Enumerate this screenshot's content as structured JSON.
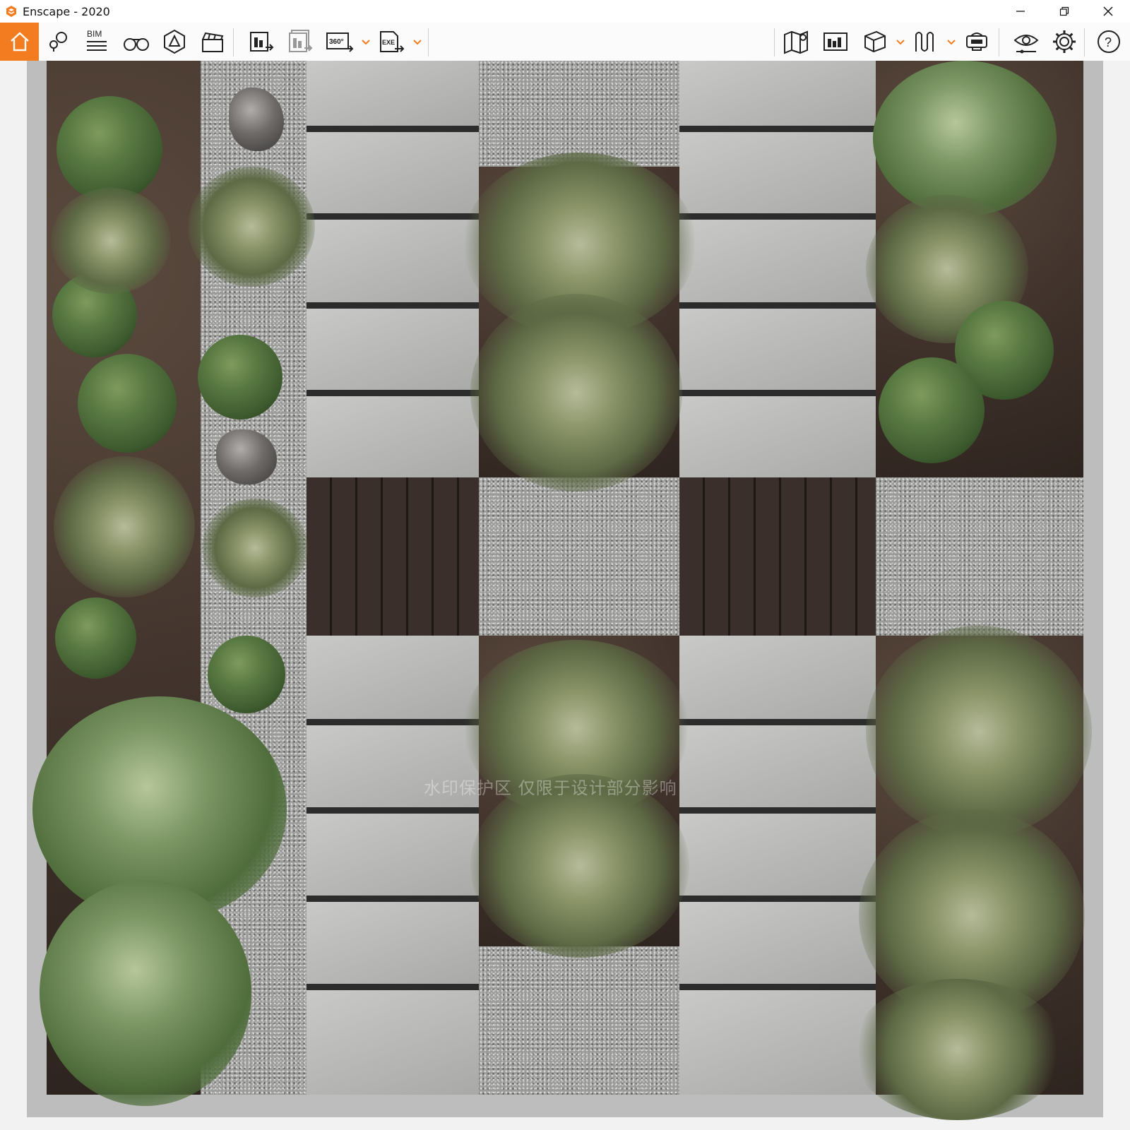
{
  "window": {
    "app_name": "Enscape - 2020",
    "controls": [
      "minimize-icon",
      "restore-icon",
      "close-icon"
    ]
  },
  "toolbar": {
    "accent_color": "#f47c20",
    "left_tools": [
      {
        "icon": "home-icon"
      },
      {
        "icon": "location-pins-icon"
      },
      {
        "icon": "bim-list-icon",
        "label": "BIM"
      },
      {
        "icon": "binoculars-icon"
      },
      {
        "icon": "atmosphere-icon"
      },
      {
        "icon": "clapperboard-icon"
      },
      {
        "icon": "render-screenshot-icon"
      },
      {
        "icon": "batch-render-icon"
      },
      {
        "icon": "panorama-360-icon",
        "label": "360°"
      },
      {
        "icon": "export-exe-icon",
        "label": "EXE"
      }
    ],
    "right_tools": [
      {
        "icon": "map-icon"
      },
      {
        "icon": "asset-library-icon"
      },
      {
        "icon": "cube-icon"
      },
      {
        "icon": "material-editor-icon"
      },
      {
        "icon": "vr-headset-icon"
      },
      {
        "icon": "visual-settings-icon"
      },
      {
        "icon": "settings-gear-icon"
      },
      {
        "icon": "help-icon"
      }
    ]
  },
  "viewport": {
    "description_visible": "top-down landscape rendering",
    "watermark_text": "水印保护区 仅限于设计部分影响"
  }
}
